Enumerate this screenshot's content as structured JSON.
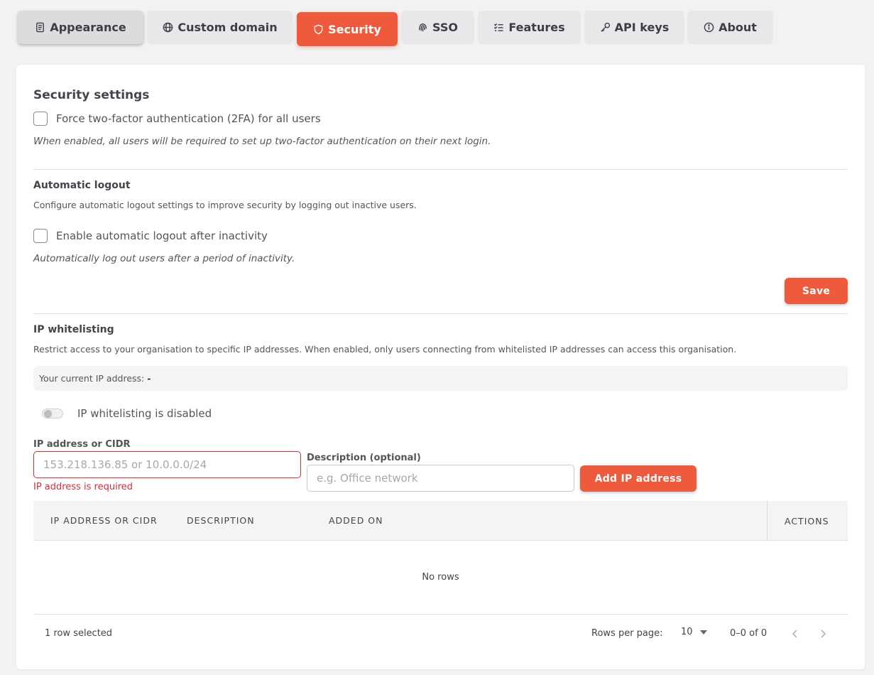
{
  "tabs": [
    {
      "label": "Appearance",
      "icon": "document-icon"
    },
    {
      "label": "Custom domain",
      "icon": "globe-icon"
    },
    {
      "label": "Security",
      "icon": "shield-icon"
    },
    {
      "label": "SSO",
      "icon": "fingerprint-icon"
    },
    {
      "label": "Features",
      "icon": "checklist-icon"
    },
    {
      "label": "API keys",
      "icon": "key-icon"
    },
    {
      "label": "About",
      "icon": "info-icon"
    }
  ],
  "security": {
    "title": "Security settings",
    "force_2fa_label": "Force two-factor authentication (2FA) for all users",
    "force_2fa_note": "When enabled, all users will be required to set up two-factor authentication on their next login."
  },
  "autologout": {
    "title": "Automatic logout",
    "description": "Configure automatic logout settings to improve security by logging out inactive users.",
    "checkbox_label": "Enable automatic logout after inactivity",
    "note": "Automatically log out users after a period of inactivity.",
    "save_label": "Save"
  },
  "ipwhitelist": {
    "title": "IP whitelisting",
    "description": "Restrict access to your organisation to specific IP addresses. When enabled, only users connecting from whitelisted IP addresses can access this organisation.",
    "current_ip_label": "Your current IP address:",
    "current_ip_value": "-",
    "toggle_label": "IP whitelisting is disabled",
    "ip_field_label": "IP address or CIDR",
    "ip_field_placeholder": "153.218.136.85 or 10.0.0.0/24",
    "ip_field_error": "IP address is required",
    "desc_field_label": "Description (optional)",
    "desc_field_placeholder": "e.g. Office network",
    "add_button_label": "Add IP address"
  },
  "table": {
    "columns": [
      "IP ADDRESS OR CIDR",
      "DESCRIPTION",
      "ADDED ON",
      "ACTIONS"
    ],
    "empty_text": "No rows",
    "selected_text": "1 row selected",
    "rows_per_page_label": "Rows per page:",
    "rows_per_page_value": "10",
    "range_text": "0–0 of 0"
  },
  "colors": {
    "accent": "#ee5b3c",
    "error": "#d0303a",
    "background": "#f2f2f4"
  }
}
